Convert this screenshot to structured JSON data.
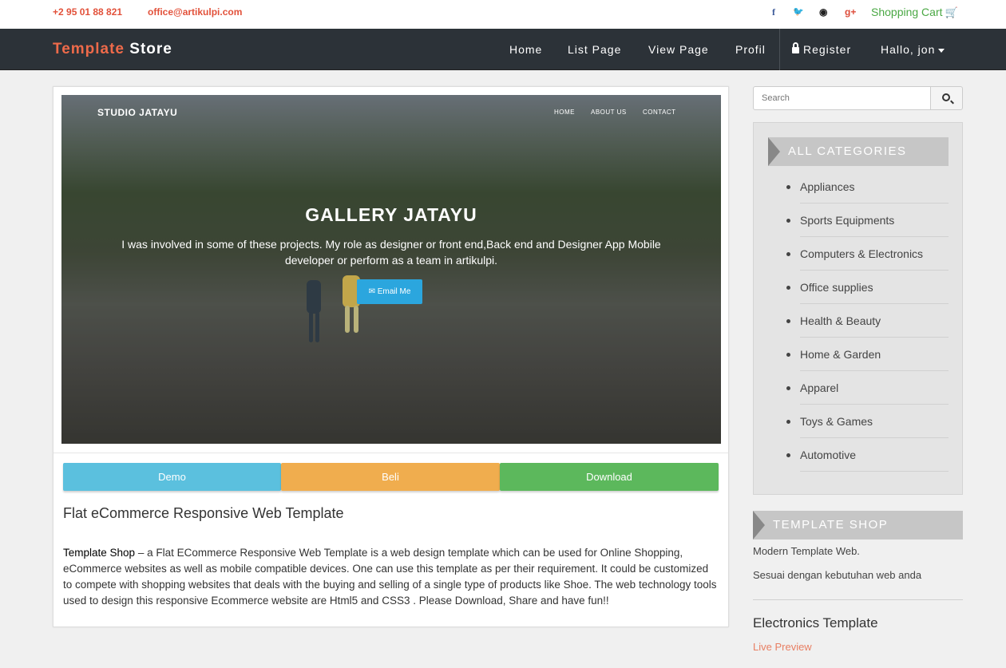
{
  "topbar": {
    "phone": "+2 95 01 88 821",
    "email": "office@artikulpi.com",
    "social": [
      {
        "name": "facebook-icon",
        "glyph": "f"
      },
      {
        "name": "twitter-icon",
        "glyph": "🐦"
      },
      {
        "name": "github-icon",
        "glyph": "◉"
      },
      {
        "name": "google-plus-icon",
        "glyph": "g+"
      }
    ],
    "cart_label": "Shopping Cart"
  },
  "navbar": {
    "brand_part1": "Template",
    "brand_part2": "Store",
    "items": [
      "Home",
      "List Page",
      "View Page",
      "Profil"
    ],
    "register": "Register",
    "user_menu": "Hallo, jon"
  },
  "preview": {
    "brand": "STUDIO JATAYU",
    "nav": [
      "HOME",
      "ABOUT US",
      "CONTACT"
    ],
    "title": "GALLERY JATAYU",
    "text": "I was involved in some of these projects. My role as designer or front end,Back end and Designer App Mobile developer or perform as a team in artikulpi.",
    "button": "✉ Email Me"
  },
  "actions": {
    "demo": "Demo",
    "beli": "Beli",
    "download": "Download"
  },
  "product": {
    "title": "Flat eCommerce Responsive Web Template",
    "desc_strong": "Template Shop",
    "desc_rest": " – a Flat ECommerce Responsive Web Template is a web design template which can be used for Online Shopping, eCommerce websites as well as mobile compatible devices. One can use this template as per their requirement. It could be customized to compete with shopping websites that deals with the buying and selling of a single type of products like Shoe. The web technology tools used to design this responsive Ecommerce website are Html5 and CSS3 . Please Download, Share and have fun!!"
  },
  "sidebar": {
    "search_placeholder": "Search",
    "categories_title": "ALL CATEGORIES",
    "categories": [
      "Appliances",
      "Sports Equipments",
      "Computers & Electronics",
      "Office supplies",
      "Health & Beauty",
      "Home & Garden",
      "Apparel",
      "Toys & Games",
      "Automotive"
    ],
    "template_shop_title": "TEMPLATE SHOP",
    "template_shop_lines": [
      "Modern Template Web.",
      "Sesuai dengan kebutuhan web anda"
    ],
    "electronics_title": "Electronics Template",
    "live_preview": "Live Preview"
  },
  "colors": {
    "accent": "#e2513a",
    "navbar": "#2c3238",
    "demo": "#5bc0de",
    "beli": "#f0ad4e",
    "download": "#5cb85c"
  }
}
